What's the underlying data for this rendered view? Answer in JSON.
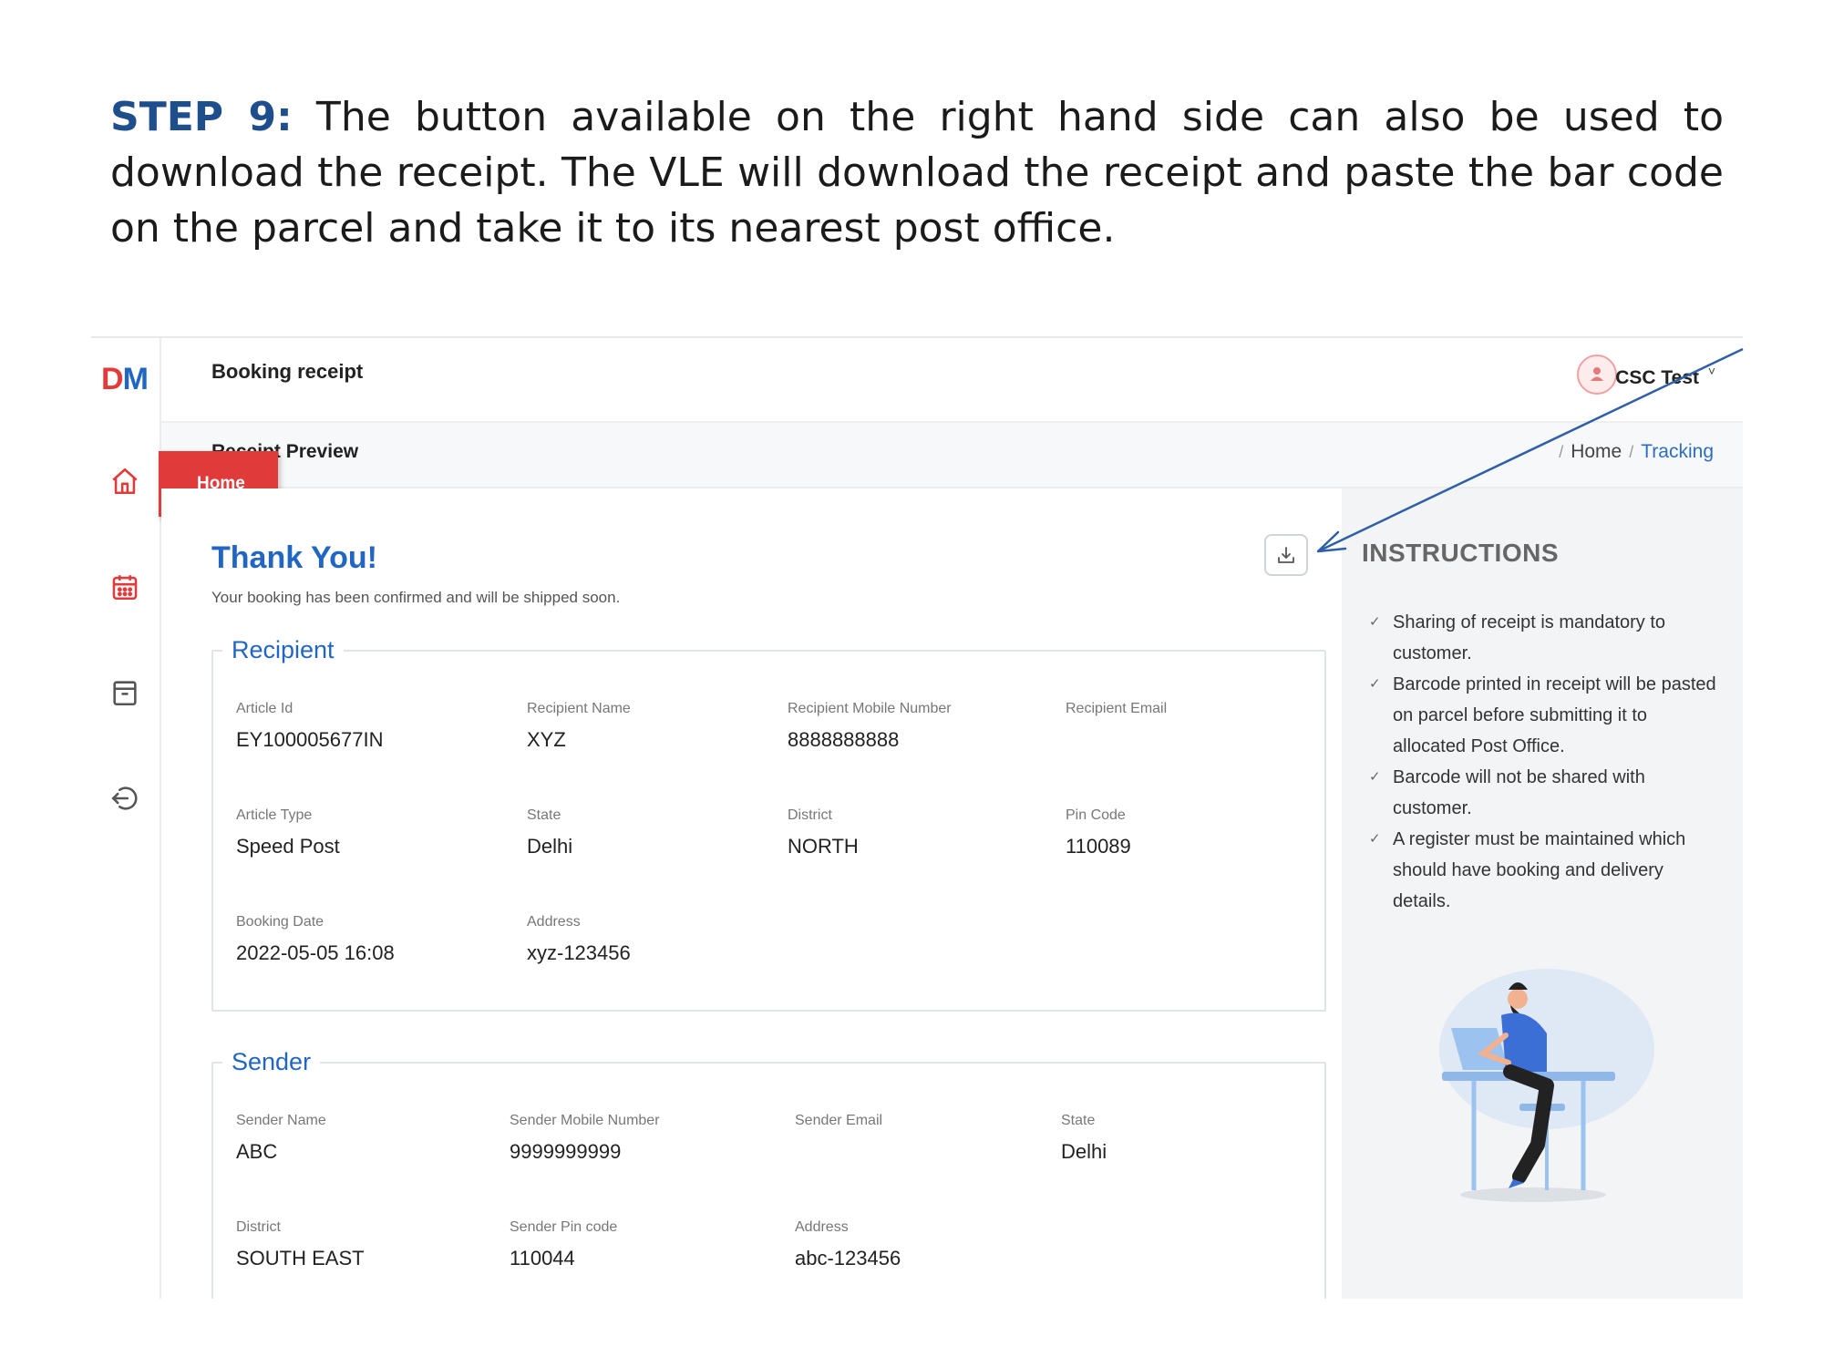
{
  "caption": {
    "step_label": "STEP 9:",
    "text": " The button available on the right hand side can also be used to download the receipt. The VLE will download the receipt and paste the bar code on the parcel and take it to its nearest post office."
  },
  "app": {
    "logo_d": "D",
    "logo_m": "M",
    "page_title": "Booking receipt",
    "sub_title": "Receipt Preview",
    "home_tooltip": "Home",
    "user": "CSC Test",
    "user_chevron": "˅",
    "breadcrumbs": [
      "Home",
      "Tracking"
    ],
    "breadcrumb_sep": "/"
  },
  "sidebar_icons": [
    "home-icon",
    "calendar-icon",
    "archive-icon",
    "logout-icon"
  ],
  "receipt": {
    "title": "Thank You!",
    "subtitle": "Your booking has been confirmed and will be shipped soon.",
    "recipient": {
      "legend": "Recipient",
      "fields": [
        {
          "label": "Article Id",
          "value": "EY100005677IN"
        },
        {
          "label": "Recipient Name",
          "value": "XYZ"
        },
        {
          "label": "Recipient Mobile Number",
          "value": "8888888888"
        },
        {
          "label": "Recipient Email",
          "value": ""
        },
        {
          "label": "Article Type",
          "value": "Speed Post"
        },
        {
          "label": "State",
          "value": "Delhi"
        },
        {
          "label": "District",
          "value": "NORTH"
        },
        {
          "label": "Pin Code",
          "value": "110089"
        },
        {
          "label": "Booking Date",
          "value": "2022-05-05 16:08"
        },
        {
          "label": "Address",
          "value": "xyz-123456"
        }
      ]
    },
    "sender": {
      "legend": "Sender",
      "fields": [
        {
          "label": "Sender Name",
          "value": "ABC"
        },
        {
          "label": "Sender Mobile Number",
          "value": "9999999999"
        },
        {
          "label": "Sender Email",
          "value": ""
        },
        {
          "label": "State",
          "value": "Delhi"
        },
        {
          "label": "District",
          "value": "SOUTH EAST"
        },
        {
          "label": "Sender Pin code",
          "value": "110044"
        },
        {
          "label": "Address",
          "value": "abc-123456"
        }
      ]
    }
  },
  "instructions": {
    "title": "INSTRUCTIONS",
    "check": "✓",
    "items": [
      "Sharing of receipt is mandatory to customer.",
      "Barcode printed in receipt will be pasted on parcel before submitting it to allocated Post Office.",
      "Barcode will not be shared with customer.",
      "A register must be maintained which should have booking and delivery details."
    ]
  },
  "colors": {
    "accent_blue": "#2166c2",
    "step_blue": "#1f4e8c",
    "tooltip_red": "#e03a3a",
    "panel_bg": "#f3f4f6"
  }
}
